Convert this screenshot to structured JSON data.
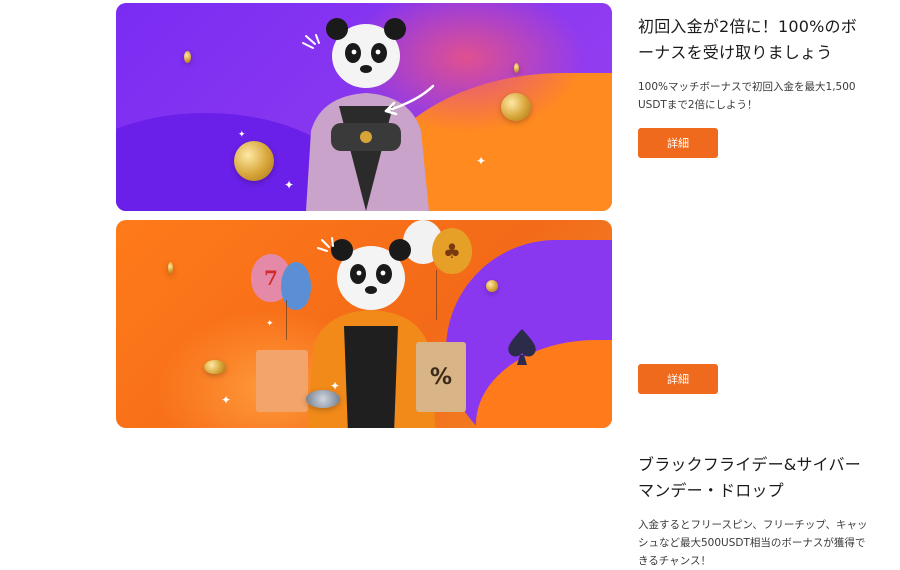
{
  "promos": [
    {
      "title": "初回入金が2倍に！100%のボーナスを受け取りましょう",
      "description": "100%マッチボーナスで初回入金を最大1,500 USDTまで2倍にしよう！",
      "button_label": "詳細",
      "banner_colors": {
        "primary": "#7a2cf2",
        "accent": "#ff8a1f"
      }
    },
    {
      "title": "ブラックフライデー&サイバーマンデー・ドロップ",
      "description": "入金するとフリースピン、フリーチップ、キャッシュなど最大500USDT相当のボーナスが獲得できるチャンス！",
      "button_label": "詳細",
      "banner_colors": {
        "primary": "#ff7a1a",
        "accent": "#8a38f0"
      },
      "balloon_glyphs": [
        "7",
        "♣"
      ],
      "bag_glyph": "%"
    }
  ],
  "colors": {
    "button": "#ef6a1d",
    "text": "#1a1a1a",
    "subtext": "#3a3a3a"
  }
}
